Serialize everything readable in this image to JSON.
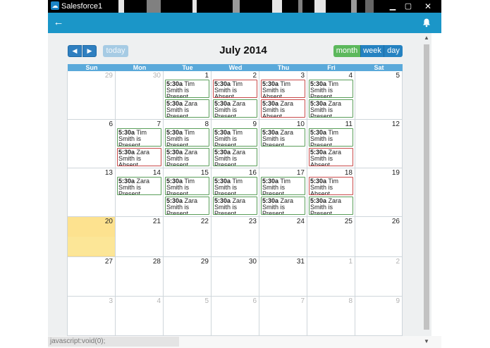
{
  "window": {
    "title": "Salesforce1",
    "app_icon": "cloud-icon"
  },
  "calendar": {
    "title": "July 2014",
    "today_label": "today",
    "views": [
      {
        "label": "month",
        "active": true
      },
      {
        "label": "week",
        "active": false
      },
      {
        "label": "day",
        "active": false
      }
    ],
    "weekdays": [
      "Sun",
      "Mon",
      "Tue",
      "Wed",
      "Thu",
      "Fri",
      "Sat"
    ],
    "weeks": [
      [
        {
          "d": "29",
          "o": true
        },
        {
          "d": "30",
          "o": true
        },
        {
          "d": "1",
          "e": [
            {
              "time": "5:30a",
              "text": "Tim Smith is Present",
              "status": "present"
            },
            {
              "time": "5:30a",
              "text": "Zara Smith is Present",
              "status": "present"
            }
          ]
        },
        {
          "d": "2",
          "e": [
            {
              "time": "5:30a",
              "text": "Tim Smith is Absent",
              "status": "absent"
            },
            {
              "time": "5:30a",
              "text": "Zara Smith is Present",
              "status": "present"
            }
          ]
        },
        {
          "d": "3",
          "e": [
            {
              "time": "5:30a",
              "text": "Tim Smith is Absent",
              "status": "absent"
            },
            {
              "time": "5:30a",
              "text": "Zara Smith is Absent",
              "status": "absent"
            }
          ]
        },
        {
          "d": "4",
          "e": [
            {
              "time": "5:30a",
              "text": "Tim Smith is Present",
              "status": "present"
            },
            {
              "time": "5:30a",
              "text": "Zara Smith is Present",
              "status": "present"
            }
          ]
        },
        {
          "d": "5"
        }
      ],
      [
        {
          "d": "6"
        },
        {
          "d": "7",
          "e": [
            {
              "time": "5:30a",
              "text": "Tim Smith is Present",
              "status": "present"
            },
            {
              "time": "5:30a",
              "text": "Zara Smith is Absent",
              "status": "absent"
            }
          ]
        },
        {
          "d": "8",
          "e": [
            {
              "time": "5:30a",
              "text": "Tim Smith is Present",
              "status": "present"
            },
            {
              "time": "5:30a",
              "text": "Zara Smith is Present",
              "status": "present"
            }
          ]
        },
        {
          "d": "9",
          "e": [
            {
              "time": "5:30a",
              "text": "Tim Smith is Present",
              "status": "present"
            },
            {
              "time": "5:30a",
              "text": "Zara Smith is Present",
              "status": "present"
            }
          ]
        },
        {
          "d": "10",
          "e": [
            {
              "time": "5:30a",
              "text": "Zara Smith is Present",
              "status": "present"
            }
          ]
        },
        {
          "d": "11",
          "e": [
            {
              "time": "5:30a",
              "text": "Tim Smith is Present",
              "status": "present"
            },
            {
              "time": "5:30a",
              "text": "Zara Smith is Absent",
              "status": "absent"
            }
          ]
        },
        {
          "d": "12"
        }
      ],
      [
        {
          "d": "13"
        },
        {
          "d": "14",
          "e": [
            {
              "time": "5:30a",
              "text": "Zara Smith is Present",
              "status": "present"
            }
          ]
        },
        {
          "d": "15",
          "e": [
            {
              "time": "5:30a",
              "text": "Tim Smith is Present",
              "status": "present"
            },
            {
              "time": "5:30a",
              "text": "Zara Smith is Present",
              "status": "present"
            }
          ]
        },
        {
          "d": "16",
          "e": [
            {
              "time": "5:30a",
              "text": "Tim Smith is Present",
              "status": "present"
            },
            {
              "time": "5:30a",
              "text": "Zara Smith is Present",
              "status": "present"
            }
          ]
        },
        {
          "d": "17",
          "e": [
            {
              "time": "5:30a",
              "text": "Tim Smith is Present",
              "status": "present"
            },
            {
              "time": "5:30a",
              "text": "Zara Smith is Present",
              "status": "present"
            }
          ]
        },
        {
          "d": "18",
          "e": [
            {
              "time": "5:30a",
              "text": "Tim Smith is Absent",
              "status": "absent"
            },
            {
              "time": "5:30a",
              "text": "Zara Smith is Present",
              "status": "present"
            }
          ]
        },
        {
          "d": "19"
        }
      ],
      [
        {
          "d": "20",
          "today": true
        },
        {
          "d": "21"
        },
        {
          "d": "22"
        },
        {
          "d": "23"
        },
        {
          "d": "24"
        },
        {
          "d": "25"
        },
        {
          "d": "26"
        }
      ],
      [
        {
          "d": "27"
        },
        {
          "d": "28"
        },
        {
          "d": "29"
        },
        {
          "d": "30"
        },
        {
          "d": "31"
        },
        {
          "d": "1",
          "o": true
        },
        {
          "d": "2",
          "o": true
        }
      ],
      [
        {
          "d": "3",
          "o": true
        },
        {
          "d": "4",
          "o": true
        },
        {
          "d": "5",
          "o": true
        },
        {
          "d": "6",
          "o": true
        },
        {
          "d": "7",
          "o": true
        },
        {
          "d": "8",
          "o": true
        },
        {
          "d": "9",
          "o": true
        }
      ]
    ]
  },
  "status_bar": {
    "text": "javascript:void(0);"
  },
  "icons": {
    "back": "back-arrow-icon",
    "bell": "bell-icon",
    "prev": "chevron-left-icon",
    "next": "chevron-right-icon"
  },
  "colors": {
    "app_bar": "#1b96c8",
    "present": "#5a9e5a",
    "absent": "#c84b4b",
    "today": "#fde28f",
    "month_active": "#5cb85c",
    "view_button": "#2582c1"
  }
}
